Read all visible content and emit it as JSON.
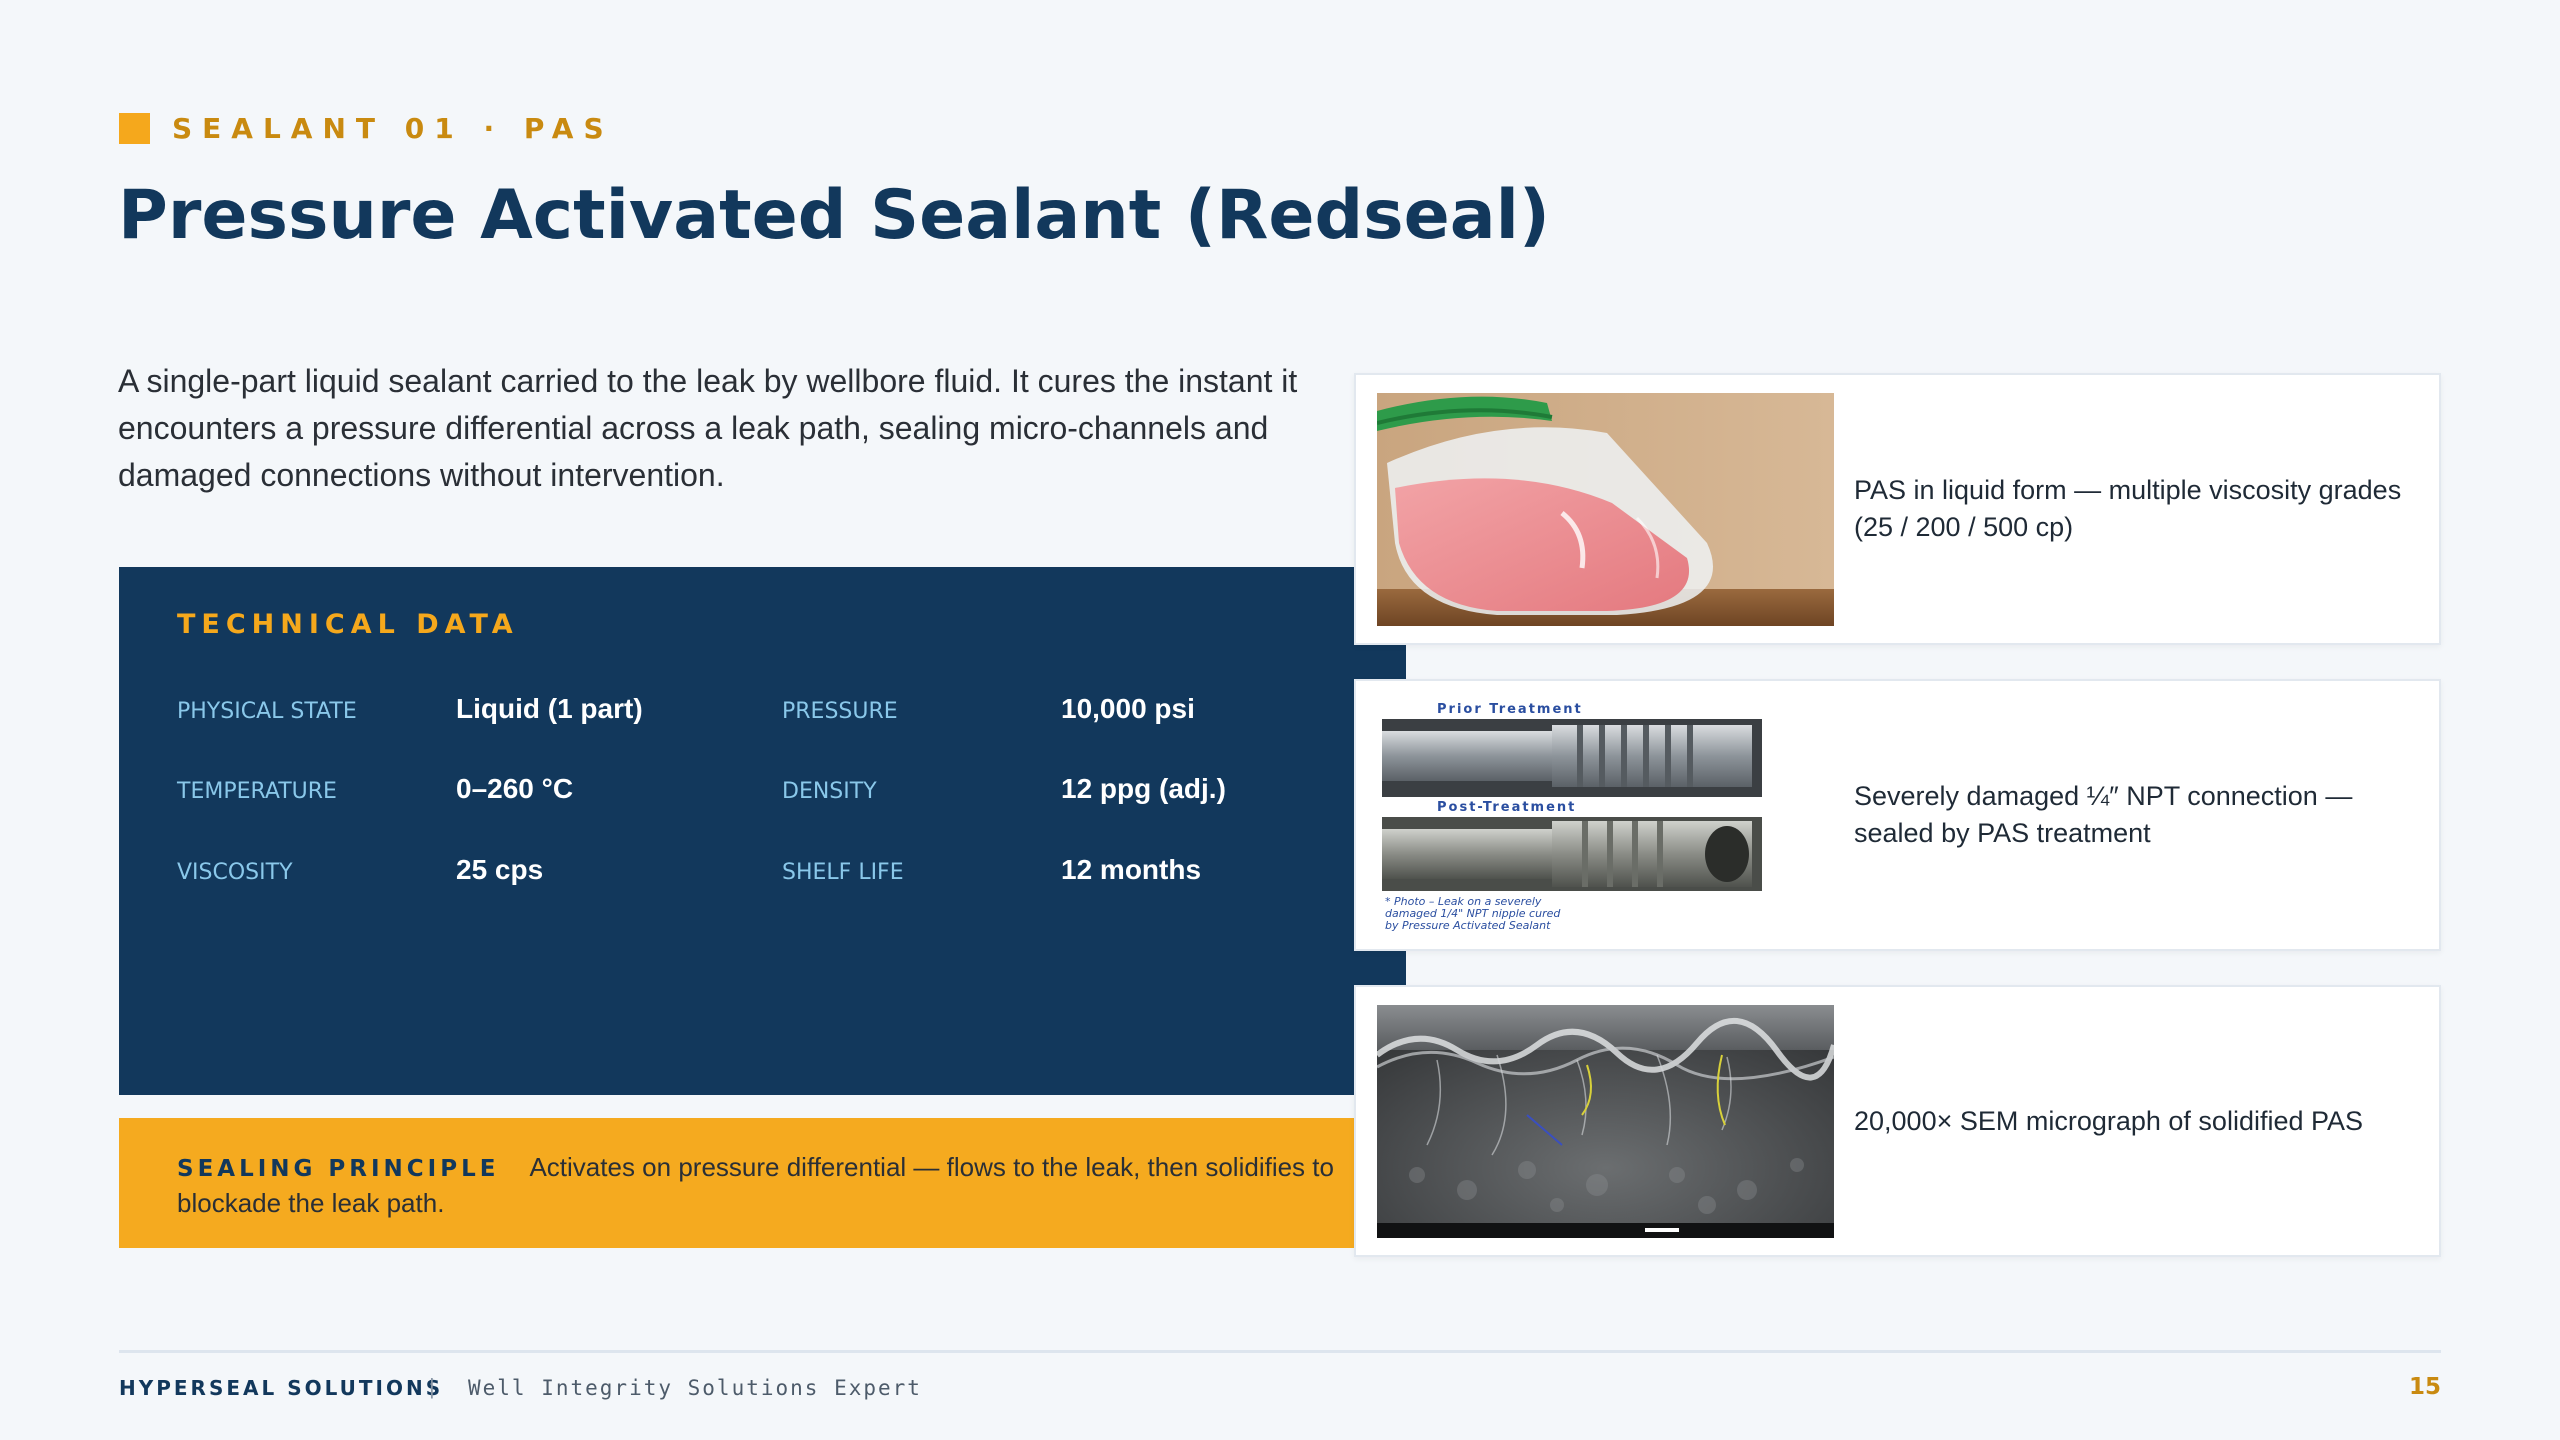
{
  "header": {
    "eyebrow": "SEALANT 01 · PAS",
    "title": "Pressure Activated Sealant (Redseal)"
  },
  "intro": "A single-part liquid sealant carried to the leak by wellbore fluid. It cures the instant it encounters a pressure differential across a leak path, sealing micro-channels and damaged connections without intervention.",
  "technical": {
    "title": "TECHNICAL DATA",
    "specs": [
      {
        "label": "PHYSICAL STATE",
        "value": "Liquid (1 part)"
      },
      {
        "label": "PRESSURE",
        "value": "10,000 psi"
      },
      {
        "label": "TEMPERATURE",
        "value": "0–260 °C"
      },
      {
        "label": "DENSITY",
        "value": "12 ppg (adj.)"
      },
      {
        "label": "VISCOSITY",
        "value": "25 cps"
      },
      {
        "label": "SHELF LIFE",
        "value": "12 months"
      }
    ]
  },
  "principle": {
    "label": "SEALING PRINCIPLE",
    "text": "Activates on pressure differential — flows to the leak, then solidifies to blockade the leak path."
  },
  "cards": [
    {
      "caption": "PAS in liquid form — multiple viscosity grades (25 / 200 / 500 cp)"
    },
    {
      "caption": "Severely damaged ¼″ NPT connection — sealed by PAS treatment",
      "image_text": {
        "top": "Prior Treatment",
        "middle": "Post-Treatment",
        "note1": "* Photo – Leak on a severely",
        "note2": "damaged 1/4\" NPT nipple cured",
        "note3": "by Pressure Activated Sealant"
      }
    },
    {
      "caption": "20,000× SEM micrograph of solidified PAS"
    }
  ],
  "footer": {
    "brand": "HYPERSEAL SOLUTIONS",
    "separator": "|",
    "tagline": "Well Integrity Solutions Expert",
    "page": "15"
  },
  "colors": {
    "navy": "#12385c",
    "accent": "#f5a81c",
    "label_blue": "#8ac8ea",
    "background": "#f4f7fa"
  }
}
